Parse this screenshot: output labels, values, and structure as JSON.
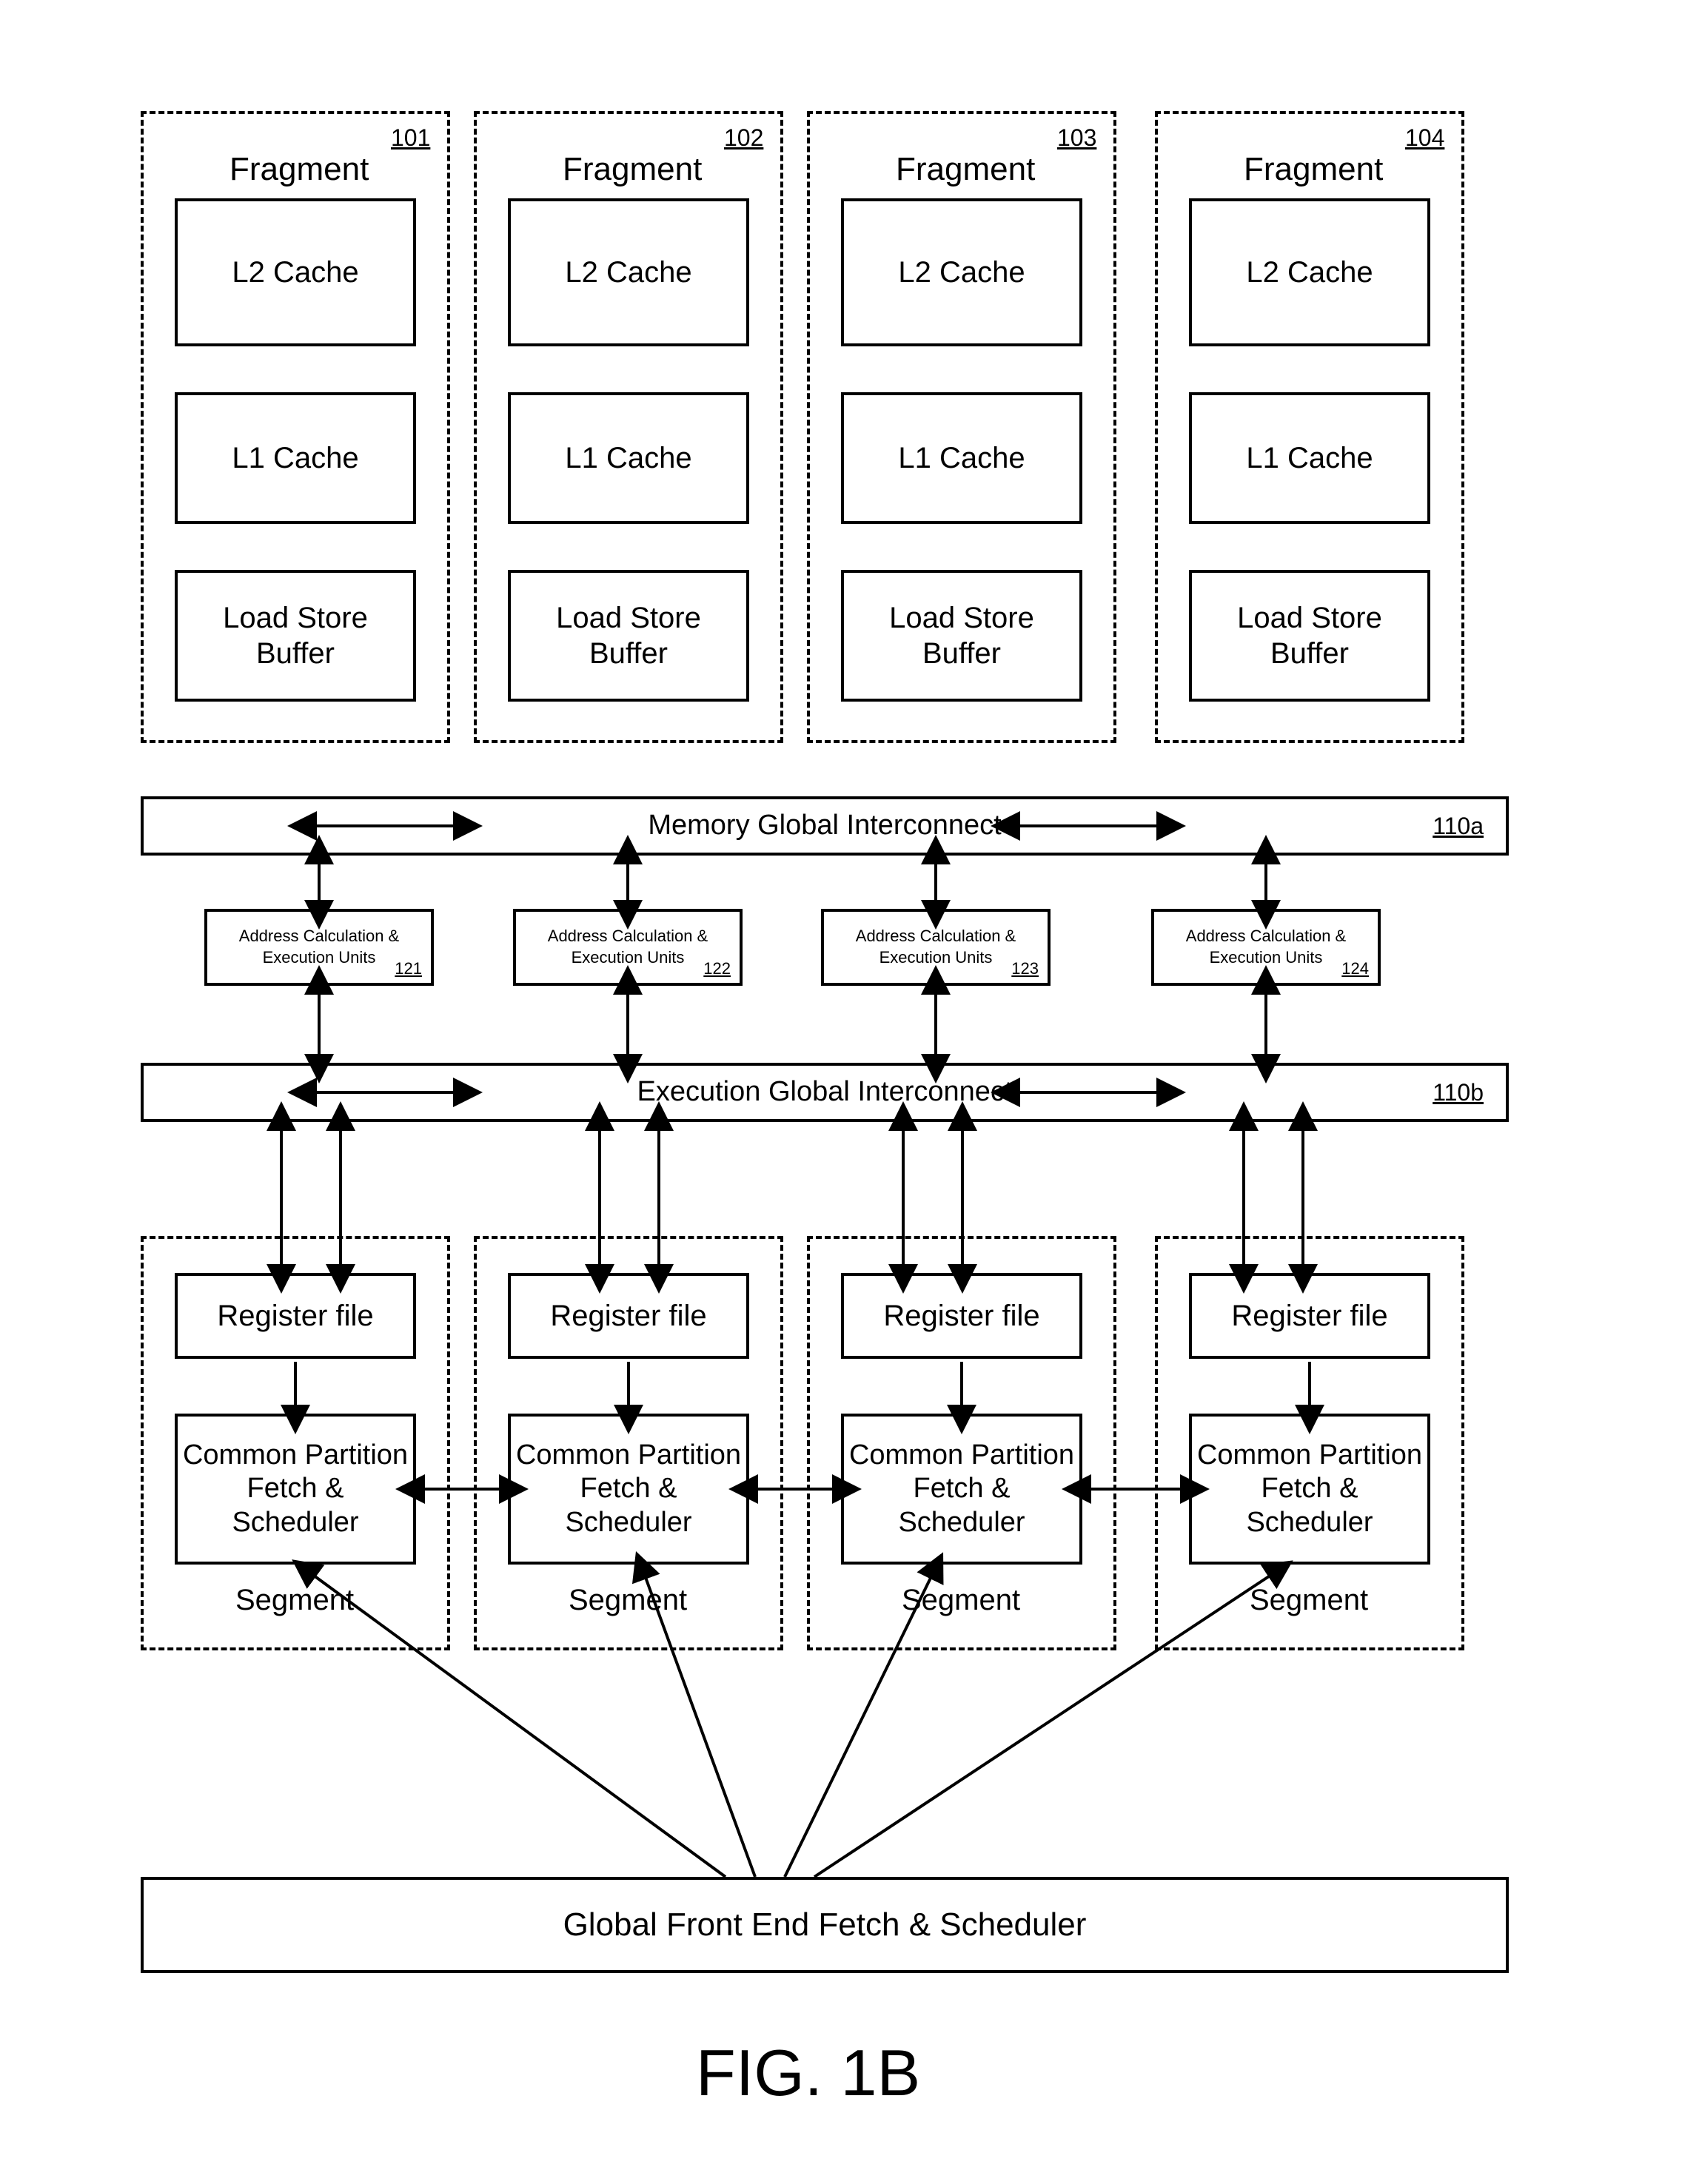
{
  "fragments": {
    "title": "Fragment",
    "l2": "L2 Cache",
    "l1": "L1 Cache",
    "lsb": "Load Store\nBuffer",
    "ids": [
      "101",
      "102",
      "103",
      "104"
    ]
  },
  "mgi": {
    "label": "Memory Global Interconnect",
    "id": "110a"
  },
  "ace": {
    "label": "Address Calculation &\nExecution Units",
    "ids": [
      "121",
      "122",
      "123",
      "124"
    ]
  },
  "egi": {
    "label": "Execution Global Interconnect",
    "id": "110b"
  },
  "segments": {
    "rf": "Register file",
    "cpfs": "Common Partition\nFetch &\nScheduler",
    "title": "Segment"
  },
  "gfe": "Global Front End Fetch & Scheduler",
  "figure": "FIG. 1B"
}
